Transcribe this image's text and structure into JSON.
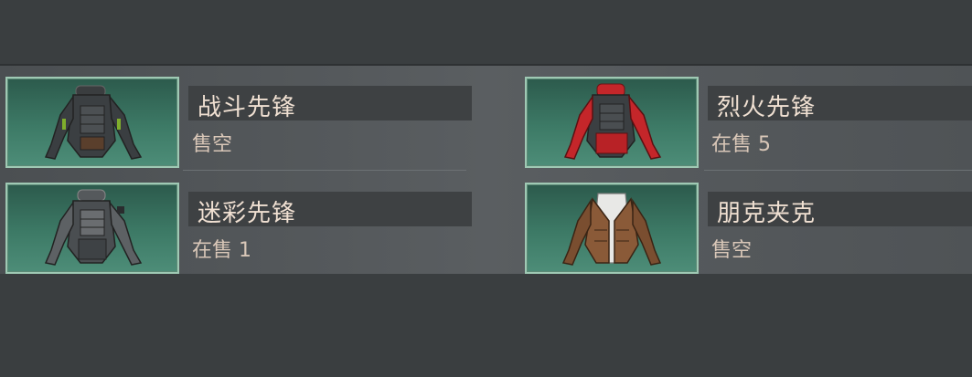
{
  "items": [
    {
      "name": "战斗先锋",
      "status": "售空",
      "accent": "#7fae2c"
    },
    {
      "name": "烈火先锋",
      "status": "在售 5",
      "accent": "#c4262a"
    },
    {
      "name": "迷彩先锋",
      "status": "在售 1",
      "accent": "#6a6d70"
    },
    {
      "name": "朋克夹克",
      "status": "售空",
      "accent": "#8a5a38"
    }
  ],
  "icons": {
    "item_thumbnail": "jacket-icon"
  }
}
